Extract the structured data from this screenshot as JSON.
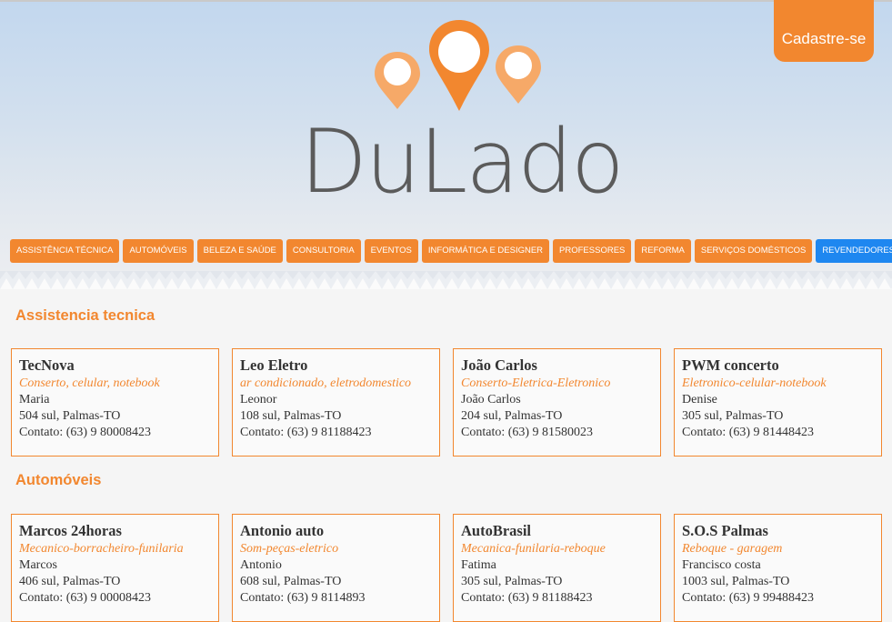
{
  "header": {
    "logo_text": "DuLado",
    "signup_label": "Cadastre-se"
  },
  "nav": {
    "items": [
      "ASSISTÊNCIA TÉCNICA",
      "AUTOMÓVEIS",
      "BELEZA E SAÚDE",
      "CONSULTORIA",
      "EVENTOS",
      "INFORMÁTICA E DESIGNER",
      "PROFESSORES",
      "REFORMA",
      "SERVIÇOS DOMÉSTICOS",
      "REVENDEDORES"
    ]
  },
  "colors": {
    "accent": "#f2872f",
    "nav_highlight": "#1e87f0",
    "text": "#333333"
  },
  "sections": [
    {
      "title": "Assistencia tecnica",
      "cards": [
        {
          "name": "TecNova",
          "tags": "Conserto, celular, notebook",
          "person": "Maria",
          "address": "504 sul, Palmas-TO",
          "contact": "Contato: (63) 9 80008423"
        },
        {
          "name": "Leo Eletro",
          "tags": "ar condicionado, eletrodomestico",
          "person": "Leonor",
          "address": "108 sul, Palmas-TO",
          "contact": "Contato: (63) 9 81188423"
        },
        {
          "name": "João Carlos",
          "tags": "Conserto-Eletrica-Eletronico",
          "person": "João Carlos",
          "address": "204 sul, Palmas-TO",
          "contact": "Contato: (63) 9 81580023"
        },
        {
          "name": "PWM concerto",
          "tags": "Eletronico-celular-notebook",
          "person": "Denise",
          "address": "305 sul, Palmas-TO",
          "contact": "Contato: (63) 9 81448423"
        }
      ]
    },
    {
      "title": "Automóveis",
      "cards": [
        {
          "name": "Marcos 24horas",
          "tags": "Mecanico-borracheiro-funilaria",
          "person": "Marcos",
          "address": "406 sul, Palmas-TO",
          "contact": "Contato: (63) 9 00008423"
        },
        {
          "name": "Antonio auto",
          "tags": "Som-peças-eletrico",
          "person": "Antonio",
          "address": "608 sul, Palmas-TO",
          "contact": "Contato: (63) 9 8114893"
        },
        {
          "name": "AutoBrasil",
          "tags": "Mecanica-funilaria-reboque",
          "person": "Fatima",
          "address": "305 sul, Palmas-TO",
          "contact": "Contato: (63) 9 81188423"
        },
        {
          "name": "S.O.S Palmas",
          "tags": "Reboque - garagem",
          "person": "Francisco costa",
          "address": "1003 sul, Palmas-TO",
          "contact": "Contato: (63) 9 99488423"
        }
      ]
    }
  ]
}
